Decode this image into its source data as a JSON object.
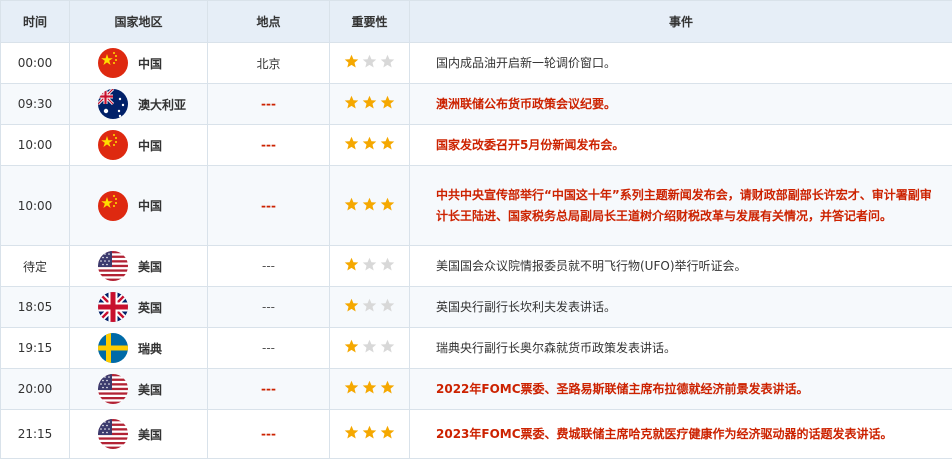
{
  "header": {
    "time": "时间",
    "country": "国家地区",
    "place": "地点",
    "importance": "重要性",
    "event": "事件"
  },
  "colors": {
    "header_bg": "#e6eef7",
    "highlight_text": "#cc2200",
    "star_on": "#f5a800",
    "star_off": "#d8d8d8"
  },
  "rows": [
    {
      "time": "00:00",
      "flag": "china",
      "country": "中国",
      "place": "北京",
      "importance": 1,
      "event": "国内成品油开启新一轮调价窗口。",
      "highlight": false
    },
    {
      "time": "09:30",
      "flag": "australia",
      "country": "澳大利亚",
      "place": "---",
      "importance": 3,
      "event": "澳洲联储公布货币政策会议纪要。",
      "highlight": true
    },
    {
      "time": "10:00",
      "flag": "china",
      "country": "中国",
      "place": "---",
      "importance": 3,
      "event": "国家发改委召开5月份新闻发布会。",
      "highlight": true
    },
    {
      "time": "10:00",
      "flag": "china",
      "country": "中国",
      "place": "---",
      "importance": 3,
      "event": "中共中央宣传部举行“中国这十年”系列主题新闻发布会，请财政部副部长许宏才、审计署副审计长王陆进、国家税务总局副局长王道树介绍财税改革与发展有关情况，并答记者问。",
      "highlight": true
    },
    {
      "time": "待定",
      "flag": "usa",
      "country": "美国",
      "place": "---",
      "importance": 1,
      "event": "美国国会众议院情报委员就不明飞行物(UFO)举行听证会。",
      "highlight": false
    },
    {
      "time": "18:05",
      "flag": "uk",
      "country": "英国",
      "place": "---",
      "importance": 1,
      "event": "英国央行副行长坎利夫发表讲话。",
      "highlight": false
    },
    {
      "time": "19:15",
      "flag": "sweden",
      "country": "瑞典",
      "place": "---",
      "importance": 1,
      "event": "瑞典央行副行长奥尔森就货币政策发表讲话。",
      "highlight": false
    },
    {
      "time": "20:00",
      "flag": "usa",
      "country": "美国",
      "place": "---",
      "importance": 3,
      "event": "2022年FOMC票委、圣路易斯联储主席布拉德就经济前景发表讲话。",
      "highlight": true
    },
    {
      "time": "21:15",
      "flag": "usa",
      "country": "美国",
      "place": "---",
      "importance": 3,
      "event": "2023年FOMC票委、费城联储主席哈克就医疗健康作为经济驱动器的话题发表讲话。",
      "highlight": true
    }
  ]
}
